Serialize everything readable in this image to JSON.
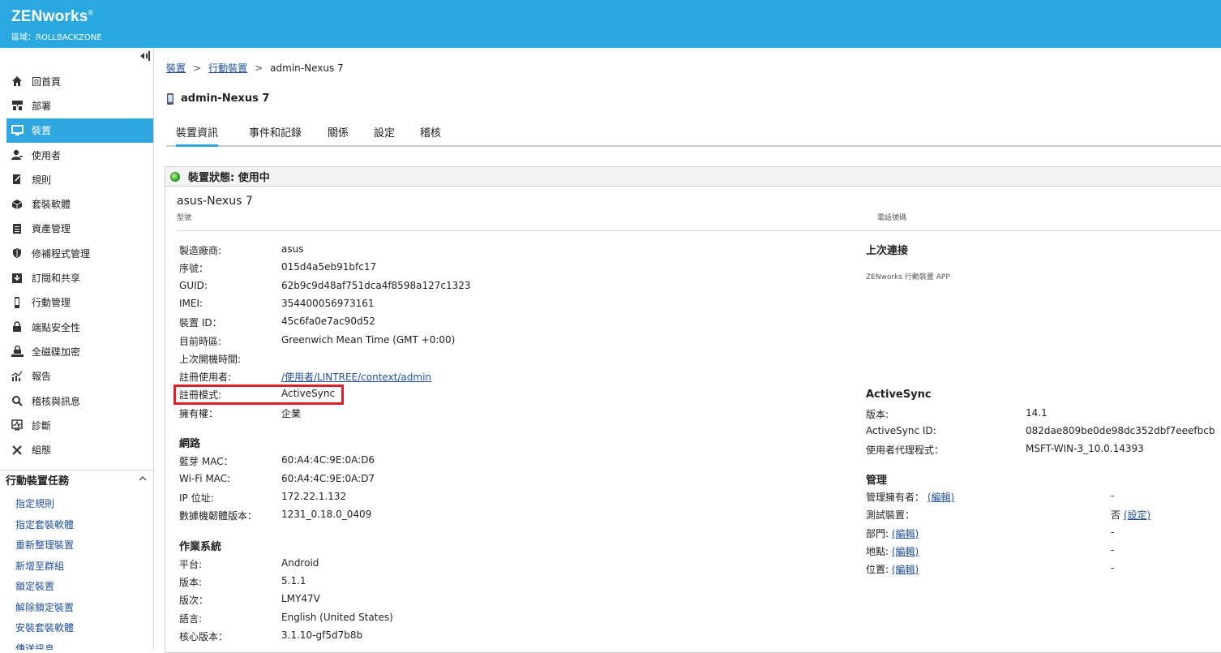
{
  "header": {
    "brand": "ZENworks",
    "reg": "®",
    "zone": "區域：ROLLBACKZONE"
  },
  "sidebar": {
    "items": [
      {
        "label": "回首頁"
      },
      {
        "label": "部署"
      },
      {
        "label": "裝置"
      },
      {
        "label": "使用者"
      },
      {
        "label": "規則"
      },
      {
        "label": "套裝軟體"
      },
      {
        "label": "資產管理"
      },
      {
        "label": "修補程式管理"
      },
      {
        "label": "訂閱和共享"
      },
      {
        "label": "行動管理"
      },
      {
        "label": "端點安全性"
      },
      {
        "label": "全磁碟加密"
      },
      {
        "label": "報告"
      },
      {
        "label": "稽核與訊息"
      },
      {
        "label": "診斷"
      },
      {
        "label": "組態"
      }
    ],
    "active_index": 2,
    "tasks_title": "行動裝置任務",
    "tasks": [
      "指定規則",
      "指定套裝軟體",
      "重新整理裝置",
      "新增至群組",
      "鎖定裝置",
      "解除鎖定裝置",
      "安裝套裝軟體",
      "傳送訊息"
    ]
  },
  "breadcrumb": {
    "item1": "裝置",
    "item2": "行動裝置",
    "current": "admin-Nexus 7"
  },
  "page_title": "admin-Nexus 7",
  "tabs": [
    "裝置資訊",
    "事件和記錄",
    "關係",
    "設定",
    "稽核"
  ],
  "status": "裝置狀態: 使用中",
  "model": {
    "value": "asus-Nexus 7",
    "label": "型號",
    "phone_label": "電話號碼"
  },
  "details": {
    "manufacturer": {
      "k": "製造廠商:",
      "v": "asus"
    },
    "serial": {
      "k": "序號：",
      "v": "015d4a5eb91bfc17"
    },
    "guid": {
      "k": "GUID:",
      "v": "62b9c9d48af751dca4f8598a127c1323"
    },
    "imei": {
      "k": "IMEI:",
      "v": "354400056973161"
    },
    "device_id": {
      "k": "裝置 ID：",
      "v": "45c6fa0e7ac90d52"
    },
    "timezone": {
      "k": "目前時區:",
      "v": "Greenwich Mean Time (GMT +0:00)"
    },
    "last_boot": {
      "k": "上次開機時間:",
      "v": ""
    },
    "enroll_user": {
      "k": "註冊使用者:",
      "v": "/使用者/LINTREE/context/admin"
    },
    "enroll_mode": {
      "k": "註冊模式:",
      "v": "ActiveSync"
    },
    "ownership": {
      "k": "擁有權：",
      "v": "企業"
    }
  },
  "network": {
    "title": "網路",
    "bt_mac": {
      "k": "藍芽 MAC：",
      "v": "60:A4:4C:9E:0A:D6"
    },
    "wifi_mac": {
      "k": "Wi-Fi MAC:",
      "v": "60:A4:4C:9E:0A:D7"
    },
    "ip": {
      "k": "IP 位址:",
      "v": "172.22.1.132"
    },
    "firmware": {
      "k": "數據機韌體版本：",
      "v": "1231_0.18.0_0409"
    }
  },
  "os": {
    "title": "作業系統",
    "platform": {
      "k": "平台:",
      "v": "Android"
    },
    "version": {
      "k": "版本:",
      "v": "5.1.1"
    },
    "build": {
      "k": "版次：",
      "v": "LMY47V"
    },
    "language": {
      "k": "語言:",
      "v": "English (United States)"
    },
    "kernel": {
      "k": "核心版本：",
      "v": "3.1.10-gf5d7b8b"
    }
  },
  "last_connection": {
    "title": "上次連接",
    "app": "ZENworks 行動裝置 APP"
  },
  "activesync": {
    "title": "ActiveSync",
    "version": {
      "k": "版本:",
      "v": "14.1"
    },
    "id": {
      "k": "ActiveSync ID:",
      "v": "082dae809be0de98dc352dbf7eeefbcb"
    },
    "agent": {
      "k": "使用者代理程式：",
      "v": "MSFT-WIN-3_10.0.14393"
    }
  },
  "management": {
    "title": "管理",
    "owner": {
      "k": "管理擁有者：",
      "link": "(編輯)",
      "v": "-"
    },
    "test_device": {
      "k": "測試裝置：",
      "v": "否",
      "link": "(設定)"
    },
    "department": {
      "k": "部門:",
      "link": "(編輯)",
      "v": "-"
    },
    "site": {
      "k": "地點:",
      "link": "(編輯)",
      "v": "-"
    },
    "location": {
      "k": "位置:",
      "link": "(編輯)",
      "v": "-"
    }
  }
}
